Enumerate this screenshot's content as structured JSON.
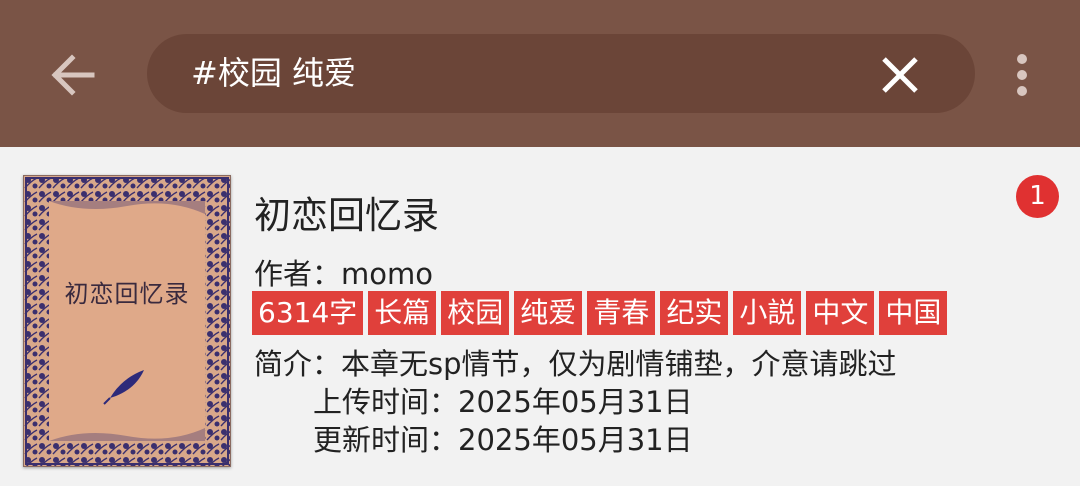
{
  "header": {
    "search_query": "#校园 纯爱",
    "back_icon": "arrow-left-icon",
    "clear_icon": "close-icon",
    "more_icon": "more-vertical-icon",
    "bar_color": "#7a5446",
    "search_bg": "#6b4538"
  },
  "book": {
    "title": "初恋回忆录",
    "cover_title": "初恋回忆录",
    "badge": "1",
    "author_label": "作者：",
    "author": "momo",
    "tags": [
      "6314字",
      "长篇",
      "校园",
      "纯爱",
      "青春",
      "纪实",
      "小説",
      "中文",
      "中国"
    ],
    "intro_label": "简介：",
    "intro": "本章无sp情节，仅为剧情铺垫，介意请跳过",
    "upload_label": "上传时间：",
    "upload_date": "2025年05月31日",
    "update_label": "更新时间：",
    "update_date": "2025年05月31日",
    "tag_color": "#e0403b",
    "badge_color": "#e03131"
  }
}
